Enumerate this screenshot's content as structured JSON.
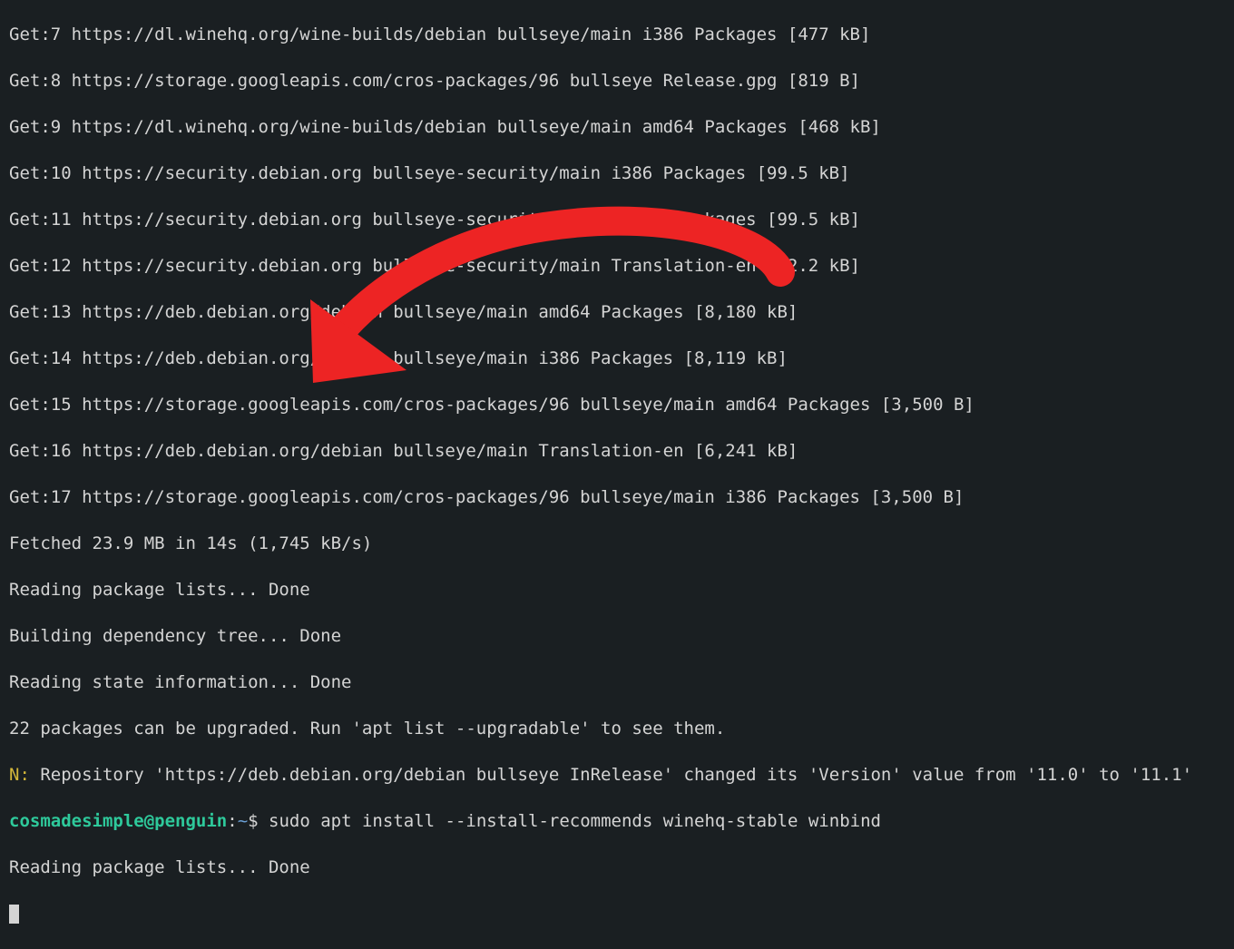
{
  "lines": {
    "l7": "Get:7 https://dl.winehq.org/wine-builds/debian bullseye/main i386 Packages [477 kB]",
    "l8": "Get:8 https://storage.googleapis.com/cros-packages/96 bullseye Release.gpg [819 B]",
    "l9": "Get:9 https://dl.winehq.org/wine-builds/debian bullseye/main amd64 Packages [468 kB]",
    "l10": "Get:10 https://security.debian.org bullseye-security/main i386 Packages [99.5 kB]",
    "l11": "Get:11 https://security.debian.org bullseye-security/main amd64 Packages [99.5 kB]",
    "l12": "Get:12 https://security.debian.org bullseye-security/main Translation-en [62.2 kB]",
    "l13": "Get:13 https://deb.debian.org/debian bullseye/main amd64 Packages [8,180 kB]",
    "l14": "Get:14 https://deb.debian.org/debian bullseye/main i386 Packages [8,119 kB]",
    "l15": "Get:15 https://storage.googleapis.com/cros-packages/96 bullseye/main amd64 Packages [3,500 B]",
    "l16": "Get:16 https://deb.debian.org/debian bullseye/main Translation-en [6,241 kB]",
    "l17": "Get:17 https://storage.googleapis.com/cros-packages/96 bullseye/main i386 Packages [3,500 B]",
    "fetched": "Fetched 23.9 MB in 14s (1,745 kB/s)",
    "reading1": "Reading package lists... Done",
    "building": "Building dependency tree... Done",
    "state": "Reading state information... Done",
    "upgradable": "22 packages can be upgraded. Run 'apt list --upgradable' to see them.",
    "notice_prefix": "N:",
    "notice_rest": " Repository 'https://deb.debian.org/debian bullseye InRelease' changed its 'Version' value from '11.0' to '11.1'",
    "reading2": "Reading package lists... Done"
  },
  "prompt": {
    "user": "cosmadesimple",
    "at": "@",
    "host": "penguin",
    "colon": ":",
    "path": "~",
    "symbol": "$ ",
    "command": "sudo apt install --install-recommends winehq-stable winbind"
  },
  "colors": {
    "arrow": "#ed2424"
  }
}
